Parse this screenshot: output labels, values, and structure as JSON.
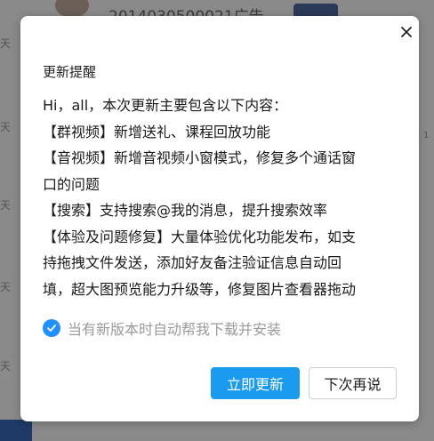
{
  "background": {
    "chat_title": "2014030500021广告",
    "day_labels": [
      "天",
      "天",
      "天",
      "天",
      "天"
    ],
    "side_mark": "1"
  },
  "dialog": {
    "title": "更新提醒",
    "notes": [
      "Hi，all，本次更新主要包含以下内容：",
      "【群视频】新增送礼、课程回放功能",
      "【音视频】新增音视频小窗模式，修复多个通话窗",
      "口的问题",
      "【搜索】支持搜索@我的消息，提升搜索效率",
      "【体验及问题修复】大量体验优化功能发布，如支",
      "持拖拽文件发送，添加好友备注验证信息自动回",
      "填，超大图预览能力升级等，修复图片查看器拖动"
    ],
    "auto_update": {
      "label": "当有新版本时自动帮我下载并安装",
      "checked": true
    },
    "buttons": {
      "update_now": "立即更新",
      "later": "下次再说"
    }
  },
  "colors": {
    "primary": "#1a9bf0",
    "checkbox": "#1e90ff",
    "overlay": "#8a8a8a"
  }
}
